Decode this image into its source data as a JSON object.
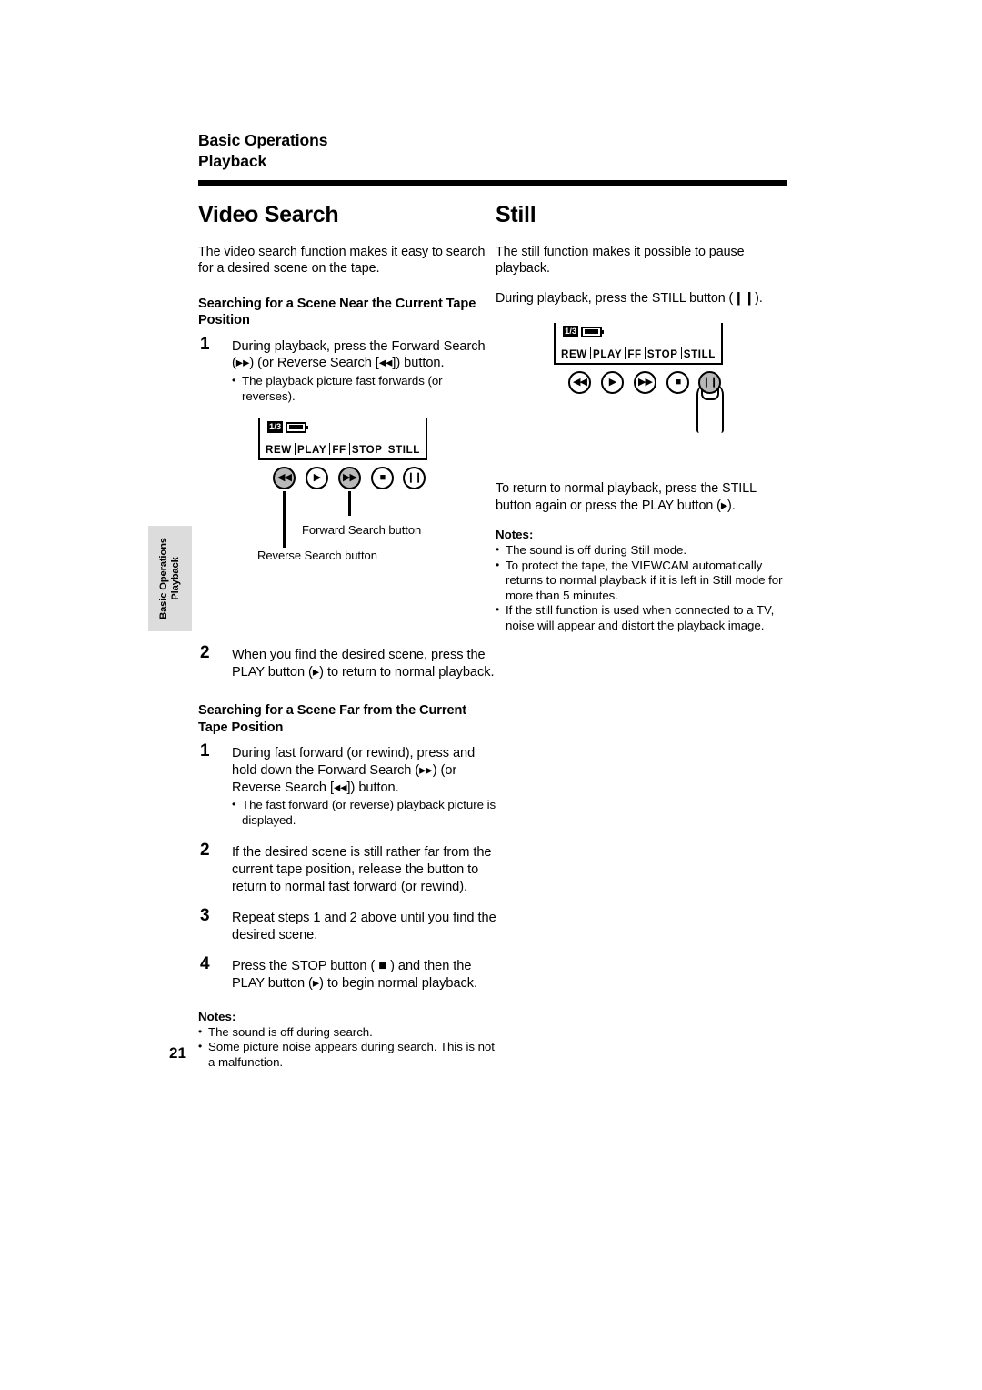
{
  "header": {
    "line1": "Basic Operations",
    "line2": "Playback"
  },
  "side_tab": {
    "line1": "Basic Operations",
    "line2": "Playback"
  },
  "page_number": "21",
  "left_column": {
    "title": "Video Search",
    "intro": "The video search function makes it easy to search for a desired scene on the tape.",
    "sub1_title": "Searching for a Scene Near the Current Tape Position",
    "step1": {
      "num": "1",
      "text": "During playback, press the Forward Search (▸▸) (or Reverse Search [◂◂]) button.",
      "bullet": "The playback picture fast forwards (or reverses)."
    },
    "diagram": {
      "status_fraction": "1/3",
      "battery_icon": "battery-icon",
      "labels": [
        "REW",
        "PLAY",
        "FF",
        "STOP",
        "STILL"
      ],
      "buttons": [
        "rewind-button",
        "play-button",
        "fast-forward-button",
        "stop-button",
        "still-button"
      ],
      "callout_forward": "Forward Search button",
      "callout_reverse": "Reverse Search button"
    },
    "step2": {
      "num": "2",
      "text": "When you find the desired scene, press the PLAY button (▸) to return to normal playback."
    },
    "sub2_title": "Searching for a Scene Far from the Current Tape Position",
    "step3": {
      "num": "1",
      "text": "During fast forward (or rewind), press and hold down the Forward Search (▸▸) (or Reverse Search [◂◂]) button.",
      "bullet": "The fast forward (or reverse) playback picture is displayed."
    },
    "step4": {
      "num": "2",
      "text": "If the desired scene is still rather far from the current tape position, release the button to return to normal fast forward (or rewind)."
    },
    "step5": {
      "num": "3",
      "text": "Repeat steps 1 and 2 above until you find the desired scene."
    },
    "step6": {
      "num": "4",
      "text": "Press the STOP button ( ■ ) and then the PLAY button (▸) to begin normal playback."
    },
    "notes_title": "Notes:",
    "notes": [
      "The sound is off during search.",
      "Some picture noise appears during search. This is not a malfunction."
    ]
  },
  "right_column": {
    "title": "Still",
    "intro": "The still function makes it possible to pause playback.",
    "instruction": "During playback, press the STILL button (❙❙).",
    "diagram": {
      "status_fraction": "1/3",
      "battery_icon": "battery-icon",
      "labels": [
        "REW",
        "PLAY",
        "FF",
        "STOP",
        "STILL"
      ],
      "buttons": [
        "rewind-button",
        "play-button",
        "fast-forward-button",
        "stop-button",
        "still-button"
      ],
      "finger": "finger-pressing-still-button"
    },
    "return_text": "To return to normal playback, press the STILL button again or press the PLAY button (▸).",
    "notes_title": "Notes:",
    "notes": [
      "The sound is off during Still mode.",
      "To protect the tape, the VIEWCAM automatically returns to normal playback if it is left in Still mode for more than 5 minutes.",
      "If the still function is used when connected to a TV, noise will appear and distort the playback image."
    ]
  }
}
